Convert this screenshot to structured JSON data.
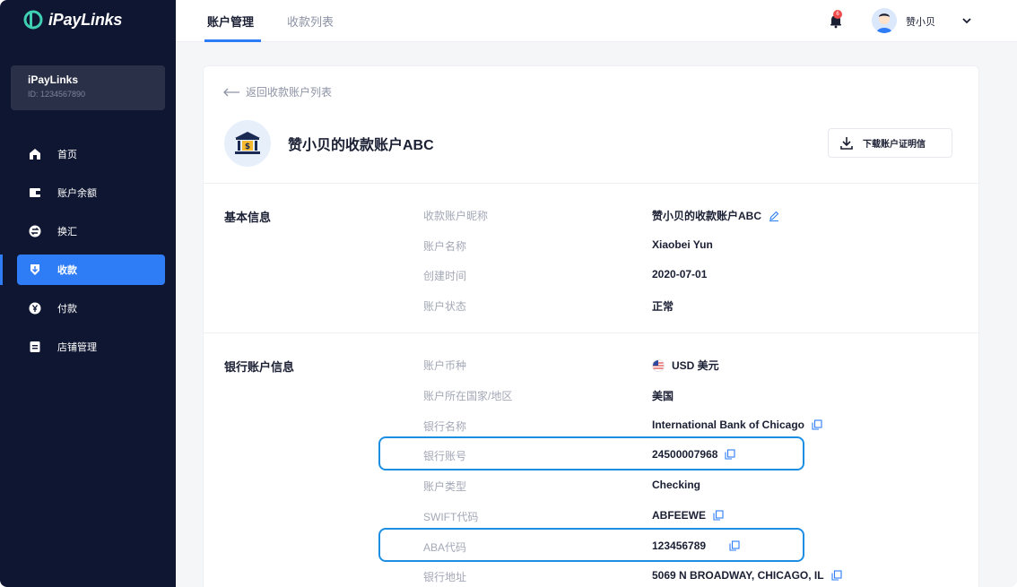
{
  "app": {
    "logo_text": "iPayLinks",
    "account_name": "iPayLinks",
    "account_id": "ID: 1234567890"
  },
  "sidebar": {
    "items": [
      {
        "label": "首页",
        "icon": "home-icon"
      },
      {
        "label": "账户余额",
        "icon": "wallet-icon"
      },
      {
        "label": "换汇",
        "icon": "exchange-icon"
      },
      {
        "label": "收款",
        "icon": "receive-icon",
        "active": true
      },
      {
        "label": "付款",
        "icon": "yen-icon"
      },
      {
        "label": "店铺管理",
        "icon": "store-icon"
      }
    ]
  },
  "header": {
    "tabs": [
      {
        "label": "账户管理",
        "active": true
      },
      {
        "label": "收款列表",
        "active": false
      }
    ],
    "notification_count": "6",
    "user_name": "赞小贝"
  },
  "content": {
    "back_link": "返回收款账户列表",
    "account_title": "赞小贝的收款账户ABC",
    "download_button": "下载账户证明信",
    "basic_section": {
      "title": "基本信息",
      "rows": [
        {
          "label": "收款账户昵称",
          "value": "赞小贝的收款账户ABC"
        },
        {
          "label": "账户名称",
          "value": "Xiaobei Yun"
        },
        {
          "label": "创建时间",
          "value": "2020-07-01"
        },
        {
          "label": "账户状态",
          "value": "正常"
        }
      ]
    },
    "bank_section": {
      "title": "银行账户信息",
      "rows": [
        {
          "label": "账户币种",
          "value": "USD 美元"
        },
        {
          "label": "账户所在国家/地区",
          "value": "美国"
        },
        {
          "label": "银行名称",
          "value": "International Bank of Chicago"
        },
        {
          "label": "银行账号",
          "value": "24500007968"
        },
        {
          "label": "账户类型",
          "value": "Checking"
        },
        {
          "label": "SWIFT代码",
          "value": "ABFEEWE"
        },
        {
          "label": "ABA代码",
          "value": "123456789"
        },
        {
          "label": "银行地址",
          "value": "5069 N BROADWAY, CHICAGO, IL"
        }
      ]
    }
  },
  "colors": {
    "sidebar_bg": "#0f1631",
    "accent": "#2e7cf6",
    "highlight": "#1c8fe3"
  }
}
